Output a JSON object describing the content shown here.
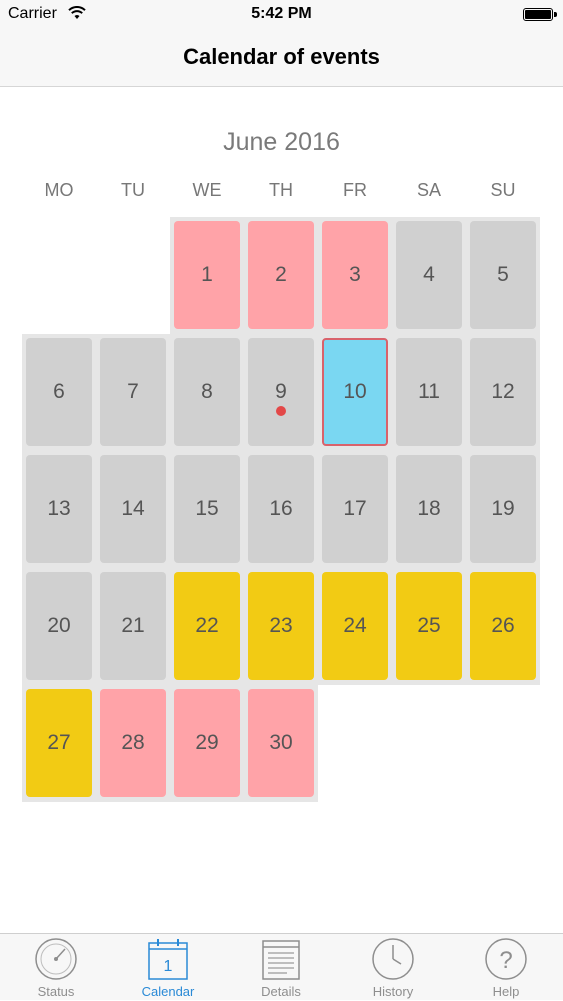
{
  "status_bar": {
    "carrier": "Carrier",
    "time": "5:42 PM",
    "icons": [
      "wifi-icon",
      "battery-icon"
    ]
  },
  "nav": {
    "title": "Calendar of events"
  },
  "calendar": {
    "month_label": "June 2016",
    "weekdays": [
      "MO",
      "TU",
      "WE",
      "TH",
      "FR",
      "SA",
      "SU"
    ],
    "colors": {
      "normal": "#d0d0d0",
      "pink": "#ffa3a8",
      "yellow": "#f2cb14",
      "today": "#7ad7f2",
      "today_border": "#d9626b",
      "event_dot": "#e34848"
    },
    "days": [
      {
        "day": "1",
        "status": "pink"
      },
      {
        "day": "2",
        "status": "pink"
      },
      {
        "day": "3",
        "status": "pink"
      },
      {
        "day": "4",
        "status": "normal"
      },
      {
        "day": "5",
        "status": "normal"
      },
      {
        "day": "6",
        "status": "normal"
      },
      {
        "day": "7",
        "status": "normal"
      },
      {
        "day": "8",
        "status": "normal"
      },
      {
        "day": "9",
        "status": "normal",
        "has_event": true
      },
      {
        "day": "10",
        "status": "today"
      },
      {
        "day": "11",
        "status": "normal"
      },
      {
        "day": "12",
        "status": "normal"
      },
      {
        "day": "13",
        "status": "normal"
      },
      {
        "day": "14",
        "status": "normal"
      },
      {
        "day": "15",
        "status": "normal"
      },
      {
        "day": "16",
        "status": "normal"
      },
      {
        "day": "17",
        "status": "normal"
      },
      {
        "day": "18",
        "status": "normal"
      },
      {
        "day": "19",
        "status": "normal"
      },
      {
        "day": "20",
        "status": "normal"
      },
      {
        "day": "21",
        "status": "normal"
      },
      {
        "day": "22",
        "status": "yellow"
      },
      {
        "day": "23",
        "status": "yellow"
      },
      {
        "day": "24",
        "status": "yellow"
      },
      {
        "day": "25",
        "status": "yellow"
      },
      {
        "day": "26",
        "status": "yellow"
      },
      {
        "day": "27",
        "status": "yellow"
      },
      {
        "day": "28",
        "status": "pink"
      },
      {
        "day": "29",
        "status": "pink"
      },
      {
        "day": "30",
        "status": "pink"
      }
    ]
  },
  "tab_bar": {
    "active_color": "#2a8ad6",
    "tabs": [
      {
        "label": "Status",
        "icon": "gauge-icon",
        "active": false
      },
      {
        "label": "Calendar",
        "icon": "calendar-icon",
        "active": true,
        "icon_text": "1"
      },
      {
        "label": "Details",
        "icon": "document-icon",
        "active": false
      },
      {
        "label": "History",
        "icon": "clock-icon",
        "active": false
      },
      {
        "label": "Help",
        "icon": "help-icon",
        "active": false
      }
    ]
  }
}
